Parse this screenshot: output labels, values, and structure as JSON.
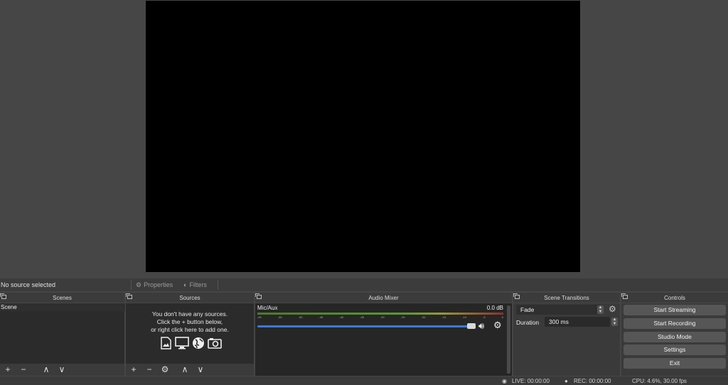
{
  "context_bar": {
    "no_source": "No source selected",
    "properties": "Properties",
    "filters": "Filters"
  },
  "docks": {
    "scenes": {
      "title": "Scenes",
      "items": [
        "Scene"
      ]
    },
    "sources": {
      "title": "Sources",
      "empty_line1": "You don't have any sources.",
      "empty_line2": "Click the + button below,",
      "empty_line3": "or right click here to add one."
    },
    "mixer": {
      "title": "Audio Mixer",
      "track_name": "Mic/Aux",
      "level": "0.0 dB",
      "ticks": [
        "-60",
        "-55",
        "-50",
        "-45",
        "-40",
        "-35",
        "-30",
        "-25",
        "-20",
        "-15",
        "-10",
        "-5",
        "0"
      ],
      "volume": 1.0
    },
    "transitions": {
      "title": "Scene Transitions",
      "selected": "Fade",
      "duration_label": "Duration",
      "duration_value": "300 ms"
    },
    "controls": {
      "title": "Controls",
      "start_streaming": "Start Streaming",
      "start_recording": "Start Recording",
      "studio_mode": "Studio Mode",
      "settings": "Settings",
      "exit": "Exit"
    }
  },
  "toolbar_icons": {
    "add": "+",
    "remove": "−",
    "up": "∧",
    "down": "∨",
    "gear": "⚙"
  },
  "status": {
    "live": "LIVE: 00:00:00",
    "rec": "REC: 00:00:00",
    "cpu": "CPU: 4.6%, 30.00 fps"
  },
  "colors": {
    "accent": "#3a7ad8",
    "background": "#464646",
    "panel": "#2b2b2b"
  }
}
